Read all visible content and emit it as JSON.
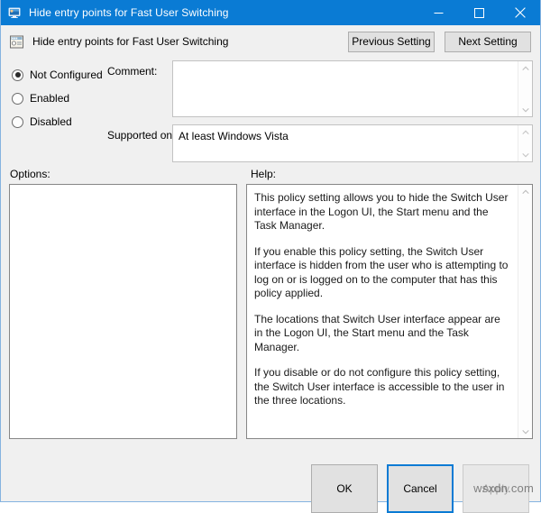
{
  "titlebar": {
    "icon": "monitor-display-icon",
    "title": "Hide entry points for Fast User Switching",
    "minimize_label": "–",
    "maximize_label": "□",
    "close_label": "✕"
  },
  "header": {
    "icon": "policy-setting-icon",
    "title": "Hide entry points for Fast User Switching",
    "previous_setting": "Previous Setting",
    "next_setting": "Next Setting"
  },
  "state": {
    "options": [
      {
        "label": "Not Configured",
        "selected": true
      },
      {
        "label": "Enabled",
        "selected": false
      },
      {
        "label": "Disabled",
        "selected": false
      }
    ]
  },
  "comment": {
    "label": "Comment:",
    "value": "",
    "placeholder": ""
  },
  "supported_on": {
    "label": "Supported on:",
    "value": "At least Windows Vista"
  },
  "sections": {
    "options_label": "Options:",
    "help_label": "Help:"
  },
  "options_panel": {
    "content": ""
  },
  "help_panel": {
    "paragraphs": [
      "This policy setting allows you to hide the Switch User interface in the Logon UI, the Start menu and the Task Manager.",
      "If you enable this policy setting, the Switch User interface is hidden from the user who is attempting to log on or is logged on to the computer that has this policy applied.",
      "The locations that Switch User interface appear are in the Logon UI, the Start menu and the Task Manager.",
      "If you disable or do not configure this policy setting, the Switch User interface is accessible to the user in the three locations."
    ]
  },
  "footer": {
    "ok": "OK",
    "cancel": "Cancel",
    "apply": "Apply"
  },
  "watermark": {
    "text": "wsxdn.com"
  },
  "colors": {
    "titlebar": "#0a7bd4",
    "accent": "#0a7bd4",
    "window_bg": "#f0f0f0",
    "field_bg": "#ffffff",
    "disabled_text": "#a0a0a0"
  }
}
